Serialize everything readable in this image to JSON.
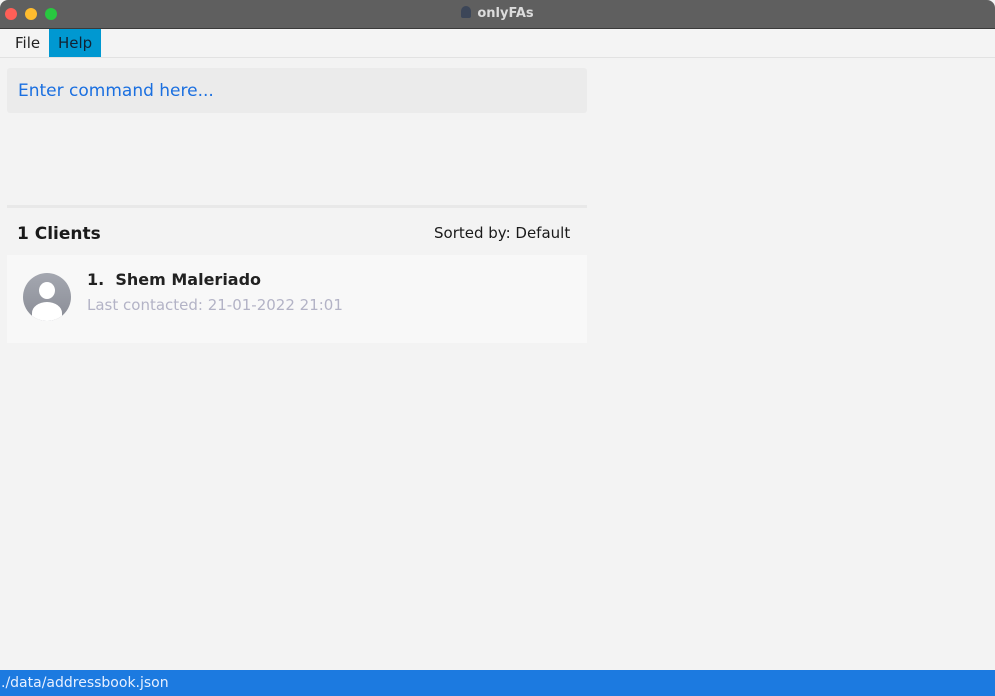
{
  "window": {
    "title": "onlyFAs"
  },
  "menu": {
    "items": [
      {
        "label": "File"
      },
      {
        "label": "Help"
      }
    ]
  },
  "command": {
    "placeholder": "Enter command here..."
  },
  "list": {
    "count_label": "1 Clients",
    "sorted_label": "Sorted by: Default",
    "clients": [
      {
        "index": "1.",
        "name": "Shem Maleriado",
        "last_contacted": "Last contacted: 21-01-2022 21:01"
      }
    ]
  },
  "status": {
    "path": "./data/addressbook.json"
  },
  "colors": {
    "accent": "#1c7ae0",
    "menu_active": "#0098d1"
  }
}
